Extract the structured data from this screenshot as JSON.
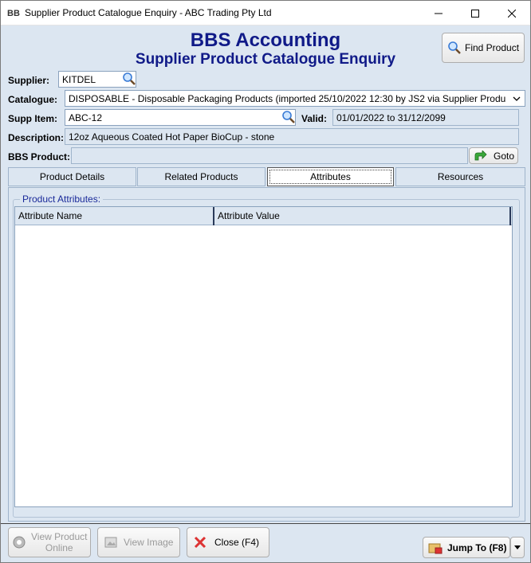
{
  "window": {
    "title": "Supplier Product Catalogue Enquiry - ABC Trading Pty Ltd",
    "controls": {
      "minimize": "—",
      "maximize": "☐",
      "close": "✕"
    }
  },
  "header": {
    "app_title": "BBS Accounting",
    "subtitle": "Supplier Product Catalogue Enquiry",
    "find_product_label": "Find Product"
  },
  "form": {
    "supplier": {
      "label": "Supplier:",
      "value": "KITDEL"
    },
    "catalogue": {
      "label": "Catalogue:",
      "value": "DISPOSABLE - Disposable Packaging Products (imported 25/10/2022 12:30 by JS2 via Supplier Produ"
    },
    "supp_item": {
      "label": "Supp Item:",
      "value": "ABC-12"
    },
    "valid": {
      "label": "Valid:",
      "value": "01/01/2022 to 31/12/2099"
    },
    "description": {
      "label": "Description:",
      "value": "12oz Aqueous Coated Hot Paper BioCup - stone"
    },
    "bbs_product": {
      "label": "BBS Product:",
      "value": "",
      "goto_label": "Goto"
    }
  },
  "tabs": [
    {
      "label": "Product Details"
    },
    {
      "label": "Related Products"
    },
    {
      "label": "Attributes",
      "active": true
    },
    {
      "label": "Resources"
    }
  ],
  "attributes": {
    "group_title": "Product Attributes:",
    "columns": [
      "Attribute Name",
      "Attribute Value"
    ],
    "rows": []
  },
  "footer": {
    "view_online_line1": "View Product",
    "view_online_line2": "Online",
    "view_image_label": "View Image",
    "close_label": "Close (F4)",
    "jump_to_label": "Jump To (F8)"
  },
  "colors": {
    "title_blue": "#101a88",
    "panel_bg": "#dce6f1",
    "field_border": "#8aa2bd"
  }
}
